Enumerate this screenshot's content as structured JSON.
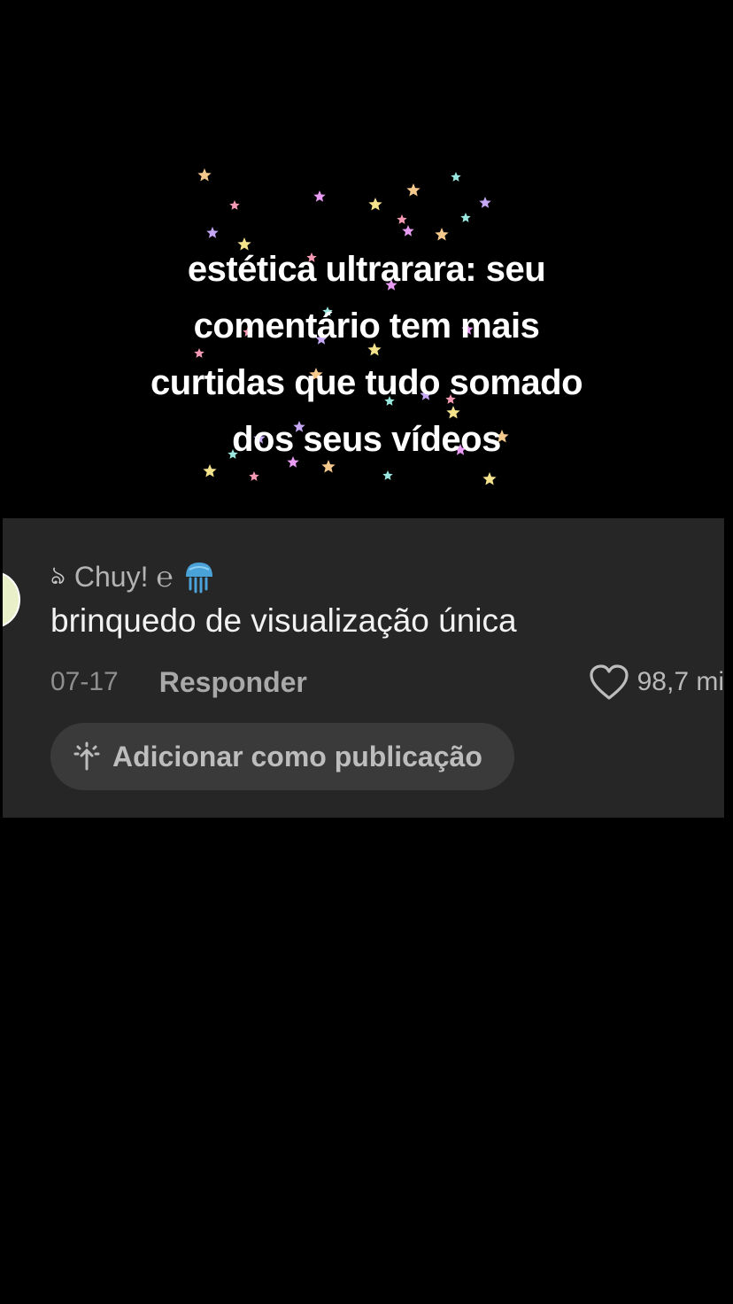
{
  "caption": {
    "line1": "estética ultrarara: seu",
    "line2": "comentário tem mais",
    "line3": "curtidas que tudo somado",
    "line4": "dos seus vídeos"
  },
  "comment": {
    "username_prefix_glyph": "ঌ",
    "username": "Chuy! ℮",
    "user_emoji": "jellyfish-icon",
    "text": "brinquedo de visualização única",
    "date": "07-17",
    "reply_label": "Responder",
    "likes": "98,7 mi",
    "add_post_label": "Adicionar como publicação"
  },
  "colors": {
    "background": "#000000",
    "card": "#262626",
    "pill": "#3a3a3a",
    "star_palette": [
      "#f59ab4",
      "#e79bf2",
      "#f5c98c",
      "#9be8e0",
      "#c6a7f5",
      "#f5e38c"
    ]
  }
}
